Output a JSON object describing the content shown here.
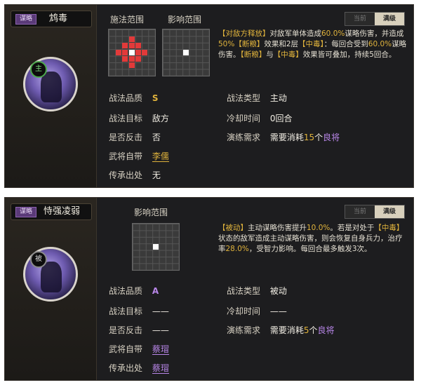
{
  "panels": [
    {
      "tag": "谋略",
      "name": "鸩毒",
      "badge": "主",
      "sec_cast": "施法范围",
      "sec_effect": "影响范围",
      "toggle": {
        "a": "当前",
        "b": "满级"
      },
      "desc": {
        "p1": "【对敌方释放】",
        "p2": "对敌军单体造成",
        "p3": "60.0%",
        "p4": "谋略伤害，并造成",
        "p5": "50%",
        "p6": "【断粮】",
        "p7": "效果和2层",
        "p8": "【中毒】",
        "p9": "：每回合受到",
        "p10": "60.0%",
        "p11": "谋略伤害。",
        "p12": "【断粮】",
        "p13": "与",
        "p14": "【中毒】",
        "p15": "效果皆可叠加，持续5回合。"
      },
      "props": {
        "quality_label": "战法品质",
        "quality": "S",
        "target_label": "战法目标",
        "target": "敌方",
        "counter_label": "是否反击",
        "counter": "否",
        "owner_label": "武将自带",
        "owner": "李儒",
        "inherit_label": "传承出处",
        "inherit": "无",
        "type_label": "战法类型",
        "type": "主动",
        "cd_label": "冷却时间",
        "cd": "0回合",
        "train_label": "演练需求",
        "train_a": "需要消耗",
        "train_n": "15",
        "train_b": "个",
        "train_c": "良将"
      }
    },
    {
      "tag": "谋略",
      "name": "恃强凌弱",
      "badge": "被",
      "sec_effect": "影响范围",
      "toggle": {
        "a": "当前",
        "b": "满级"
      },
      "desc": {
        "p1": "【被动】",
        "p2": "主动谋略伤害提升",
        "p3": "10.0%",
        "p4": "。若是对处于",
        "p5": "【中毒】",
        "p6": "状态的敌军造成主动谋略伤害，则会恢复自身兵力，治疗率",
        "p7": "28.0%",
        "p8": "，受智力影响。每回合最多触发3次。"
      },
      "props": {
        "quality_label": "战法品质",
        "quality": "A",
        "target_label": "战法目标",
        "target": "——",
        "counter_label": "是否反击",
        "counter": "——",
        "owner_label": "武将自带",
        "owner": "蔡瑁",
        "inherit_label": "传承出处",
        "inherit": "蔡瑁",
        "type_label": "战法类型",
        "type": "被动",
        "cd_label": "冷却时间",
        "cd": "——",
        "train_label": "演练需求",
        "train_a": "需要消耗",
        "train_n": "5",
        "train_b": "个",
        "train_c": "良将"
      }
    }
  ],
  "colors": {
    "gold": "#e0b33c",
    "purple": "#b886e8",
    "red": "#e23a3a"
  }
}
